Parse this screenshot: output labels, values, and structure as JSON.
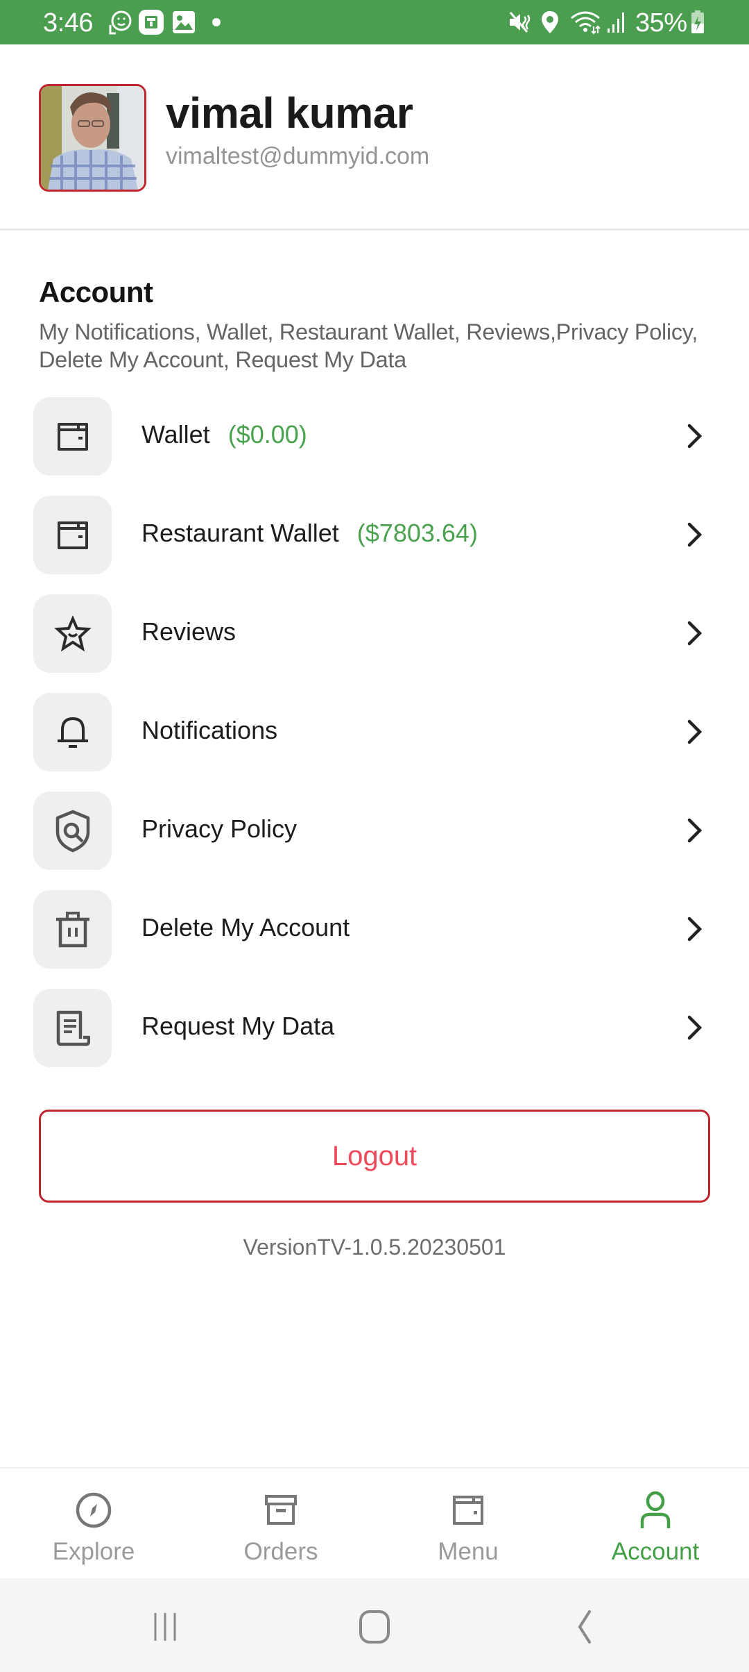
{
  "status_bar": {
    "time": "3:46",
    "left_icons": [
      "face-sticker-icon",
      "news-icon",
      "gallery-icon",
      "dot-icon"
    ],
    "right_icons": [
      "mute-icon",
      "location-icon",
      "wifi-icon",
      "signal-icon"
    ],
    "battery": "35%",
    "battery_icon": "battery-charging-icon"
  },
  "profile": {
    "name": "vimal kumar",
    "email": "vimaltest@dummyid.com"
  },
  "account_section": {
    "title": "Account",
    "description": "My Notifications, Wallet, Restaurant Wallet, Reviews,Privacy Policy, Delete My Account, Request My Data"
  },
  "menu_items": [
    {
      "label": "Wallet",
      "amount": "($0.00)",
      "icon": "wallet-icon"
    },
    {
      "label": "Restaurant Wallet",
      "amount": "($7803.64)",
      "icon": "wallet-icon"
    },
    {
      "label": "Reviews",
      "amount": null,
      "icon": "star-icon"
    },
    {
      "label": "Notifications",
      "amount": null,
      "icon": "bell-icon"
    },
    {
      "label": "Privacy Policy",
      "amount": null,
      "icon": "shield-search-icon"
    },
    {
      "label": "Delete My Account",
      "amount": null,
      "icon": "trash-icon"
    },
    {
      "label": "Request My Data",
      "amount": null,
      "icon": "document-icon"
    }
  ],
  "logout_label": "Logout",
  "version": "VersionTV-1.0.5.20230501",
  "bottom_nav": [
    {
      "label": "Explore",
      "icon": "compass-icon",
      "active": false
    },
    {
      "label": "Orders",
      "icon": "archive-box-icon",
      "active": false
    },
    {
      "label": "Menu",
      "icon": "wallet-icon",
      "active": false
    },
    {
      "label": "Account",
      "icon": "person-icon",
      "active": true
    }
  ],
  "system_nav": [
    "recent-apps",
    "home",
    "back"
  ],
  "colors": {
    "status_bar": "#4b9e50",
    "accent_green": "#43a047",
    "amount_green": "#4aa24f",
    "logout_border": "#c0262e",
    "logout_text": "#f04a5a"
  }
}
